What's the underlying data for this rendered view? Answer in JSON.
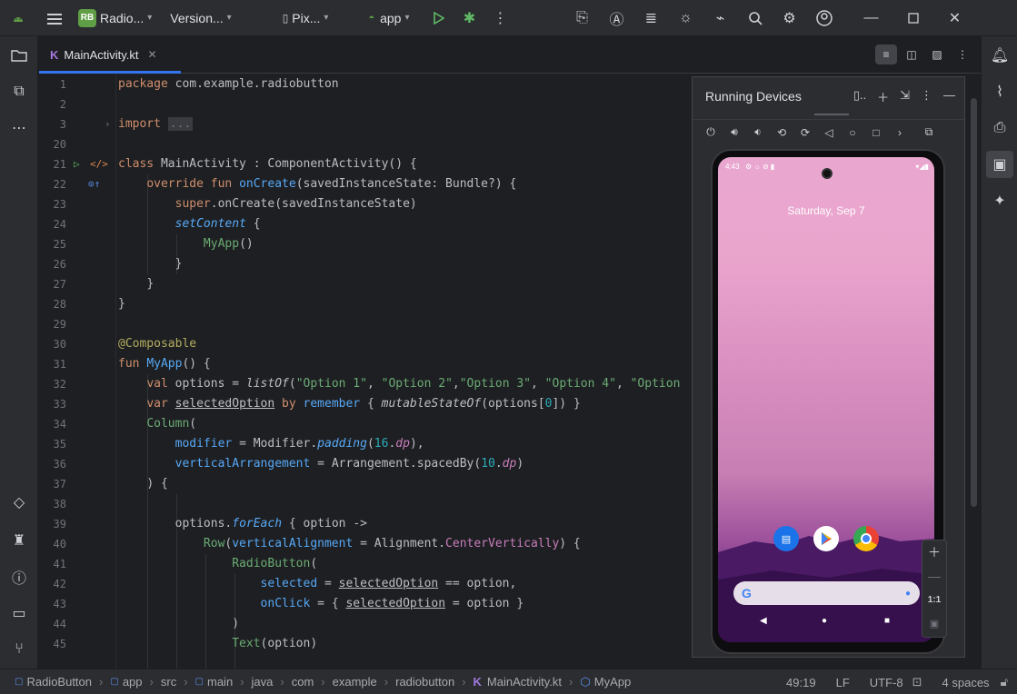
{
  "titlebar": {
    "project_badge": "RB",
    "project_name": "Radio...",
    "vcs": "Version...",
    "device": "Pix...",
    "run_config": "app"
  },
  "editor": {
    "tab_label": "MainActivity.kt",
    "lines": [
      {
        "n": "1"
      },
      {
        "n": "2"
      },
      {
        "n": "3"
      },
      {
        "n": "20"
      },
      {
        "n": "21"
      },
      {
        "n": "22"
      },
      {
        "n": "23"
      },
      {
        "n": "24"
      },
      {
        "n": "25"
      },
      {
        "n": "26"
      },
      {
        "n": "27"
      },
      {
        "n": "28"
      },
      {
        "n": "29"
      },
      {
        "n": "30"
      },
      {
        "n": "31"
      },
      {
        "n": "32"
      },
      {
        "n": "33"
      },
      {
        "n": "34"
      },
      {
        "n": "35"
      },
      {
        "n": "36"
      },
      {
        "n": "37"
      },
      {
        "n": "38"
      },
      {
        "n": "39"
      },
      {
        "n": "40"
      },
      {
        "n": "41"
      },
      {
        "n": "42"
      },
      {
        "n": "43"
      },
      {
        "n": "44"
      },
      {
        "n": "45"
      }
    ],
    "code": {
      "l1_kw": "package",
      "l1_rest": " com.example.radiobutton",
      "l3_kw": "import",
      "l3_fold": "...",
      "l21_kw": "class",
      "l21_rest": " MainActivity : ComponentActivity() {",
      "l22_kw": "override fun",
      "l22_fn": "onCreate",
      "l22_rest": "(savedInstanceState: Bundle?) {",
      "l23_kw": "super",
      "l23_rest": ".onCreate(savedInstanceState)",
      "l24_fn": "setContent",
      "l24_rest": " {",
      "l25_fn": "MyApp",
      "l25_rest": "()",
      "l26": "}",
      "l27": "}",
      "l28": "}",
      "l30": "@Composable",
      "l31_kw": "fun",
      "l31_fn": "MyApp",
      "l31_rest": "() {",
      "l32_kw": "val",
      "l32_a": " options = ",
      "l32_call": "listOf",
      "l32_b": "(",
      "l32_s1": "\"Option 1\"",
      "l32_c1": ", ",
      "l32_s2": "\"Option 2\"",
      "l32_c2": ",",
      "l32_s3": "\"Option 3\"",
      "l32_c3": ", ",
      "l32_s4": "\"Option 4\"",
      "l32_c4": ", ",
      "l32_s5": "\"Option",
      "l33_kw": "var",
      "l33_var": "selectedOption",
      "l33_by": " by ",
      "l33_fn": "remember",
      "l33_a": " { ",
      "l33_call": "mutableStateOf",
      "l33_b": "(options[",
      "l33_num": "0",
      "l33_c": "]) }",
      "l34_fn": "Column",
      "l34_rest": "(",
      "l35_prop": "modifier",
      "l35_a": " = Modifier.",
      "l35_call": "padding",
      "l35_b": "(",
      "l35_num": "16",
      "l35_c": ".",
      "l35_dp": "dp",
      "l35_d": "),",
      "l36_prop": "verticalArrangement",
      "l36_a": " = Arrangement.spacedBy(",
      "l36_num": "10",
      "l36_b": ".",
      "l36_dp": "dp",
      "l36_c": ")",
      "l37": ") {",
      "l39_a": "options.",
      "l39_call": "forEach",
      "l39_b": " { option ->",
      "l40_fn": "Row",
      "l40_a": "(",
      "l40_prop": "verticalAlignment",
      "l40_b": " = Alignment.",
      "l40_prop2": "CenterVertically",
      "l40_c": ") {",
      "l41_fn": "RadioButton",
      "l41_rest": "(",
      "l42_prop": "selected",
      "l42_a": " = ",
      "l42_var": "selectedOption",
      "l42_b": " == option,",
      "l43_prop": "onClick",
      "l43_a": " = { ",
      "l43_var": "selectedOption",
      "l43_b": " = option }",
      "l44": ")",
      "l45_fn": "Text",
      "l45_rest": "(option)"
    }
  },
  "running_devices": {
    "title": "Running Devices",
    "time": "4:43",
    "date": "Saturday, Sep 7",
    "search_logo": "G",
    "zoom_ratio": "1:1"
  },
  "statusbar": {
    "breadcrumbs": [
      "RadioButton",
      "app",
      "src",
      "main",
      "java",
      "com",
      "example",
      "radiobutton",
      "MainActivity.kt",
      "MyApp"
    ],
    "cursor": "49:19",
    "line_ending": "LF",
    "encoding": "UTF-8",
    "indent": "4 spaces"
  }
}
